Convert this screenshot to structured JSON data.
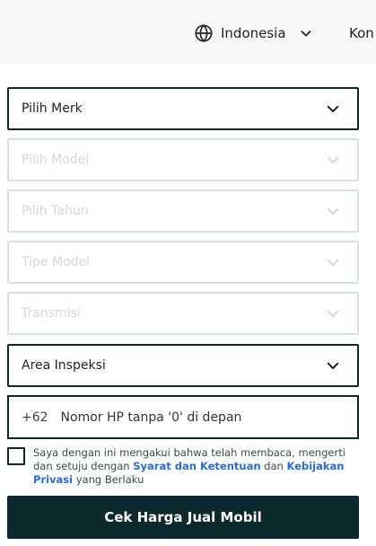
{
  "header": {
    "language_label": "Indonesia",
    "contact_label": "Kon"
  },
  "form": {
    "fields": [
      {
        "label": "Pilih Merk",
        "enabled": true
      },
      {
        "label": "Pilih Model",
        "enabled": false
      },
      {
        "label": "Pilih Tahun",
        "enabled": false
      },
      {
        "label": "Tipe Model",
        "enabled": false
      },
      {
        "label": "Transmisi",
        "enabled": false
      },
      {
        "label": "Area Inspeksi",
        "enabled": true
      }
    ],
    "phone": {
      "country_code": "+62",
      "placeholder": "Nomor HP tanpa '0' di depan",
      "value": ""
    },
    "consent": {
      "prefix": "Saya dengan ini mengakui bahwa telah membaca, mengerti dan setuju dengan ",
      "terms_link": "Syarat dan Ketentuan",
      "middle": " dan ",
      "privacy_link": "Kebijakan Privasi",
      "suffix": " yang Berlaku",
      "checked": false
    },
    "submit_label": "Cek Harga Jual Mobil"
  },
  "colors": {
    "primary": "#0c2a2d",
    "link": "#2a6ae0",
    "disabled_border": "#d9e2e2",
    "disabled_text": "#d2d9d9"
  },
  "icons": {
    "language": "globe-icon",
    "dropdown": "chevron-down-icon"
  }
}
